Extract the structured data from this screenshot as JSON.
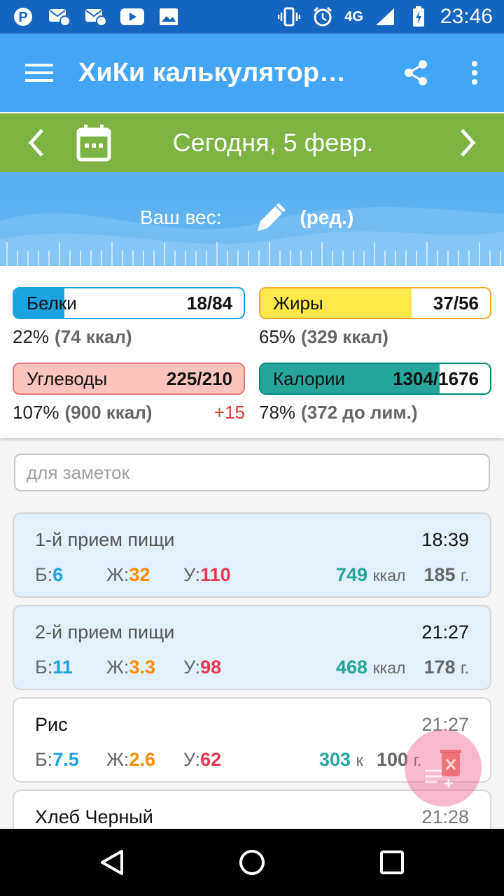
{
  "status_bar": {
    "time": "23:46",
    "network": "4G",
    "left_icons": [
      "pinterest-icon",
      "vk-mail-icon",
      "vk-mail-icon",
      "youtube-icon",
      "image-icon"
    ],
    "right_icons": [
      "vibrate-icon",
      "alarm-icon",
      "signal-icon",
      "battery-charging-icon"
    ]
  },
  "app_bar": {
    "title": "ХиКи калькулятор…",
    "icons": [
      "menu-icon",
      "share-icon",
      "more-vert-icon"
    ]
  },
  "date_bar": {
    "date": "Сегодня, 5 февр."
  },
  "weight": {
    "label": "Ваш вес:",
    "edit": "(ред.)"
  },
  "macros": {
    "protein": {
      "name": "Белки",
      "value": "18/84",
      "percent": "22%",
      "kcal": "(74 ккал)",
      "fill": 0.22,
      "color": "#1aa3e0",
      "bg": "#ffffff"
    },
    "fat": {
      "name": "Жиры",
      "value": "37/56",
      "percent": "65%",
      "kcal": "(329 ккал)",
      "fill": 0.66,
      "color": "#ffe84a",
      "border": "#f9a825"
    },
    "carbs": {
      "name": "Углеводы",
      "value": "225/210",
      "percent": "107%",
      "kcal": "(900 ккал)",
      "over": "+15",
      "fill": 1.0,
      "color": "#fbc5bd",
      "border": "#e57373"
    },
    "calories": {
      "name": "Калории",
      "value": "1304/1676",
      "percent": "78%",
      "kcal": "(372 до лим.)",
      "fill": 0.78,
      "color": "#26a69a",
      "border": "#00897b"
    }
  },
  "notes": {
    "placeholder": "для заметок"
  },
  "meals": [
    {
      "type": "meal",
      "title": "1-й прием пищи",
      "time": "18:39",
      "b_label": "Б:",
      "b": "6",
      "zh_label": "Ж:",
      "zh": "32",
      "u_label": "У:",
      "u": "110",
      "kcal": "749",
      "kcal_unit": "ккал",
      "grams": "185",
      "g_unit": "г."
    },
    {
      "type": "meal",
      "title": "2-й прием пищи",
      "time": "21:27",
      "b_label": "Б:",
      "b": "11",
      "zh_label": "Ж:",
      "zh": "3.3",
      "u_label": "У:",
      "u": "98",
      "kcal": "468",
      "kcal_unit": "ккал",
      "grams": "178",
      "g_unit": "г."
    },
    {
      "type": "item",
      "title": "Рис",
      "time": "21:27",
      "b_label": "Б:",
      "b": "7.5",
      "zh_label": "Ж:",
      "zh": "2.6",
      "u_label": "У:",
      "u": "62",
      "kcal": "303",
      "kcal_unit": "к",
      "grams": "100",
      "g_unit": "г."
    },
    {
      "type": "item",
      "title": "Хлеб Черный",
      "time": "21:28"
    }
  ],
  "fab_icon": "clear-list-icon",
  "nav_bar": [
    "back-icon",
    "home-icon",
    "recents-icon"
  ]
}
